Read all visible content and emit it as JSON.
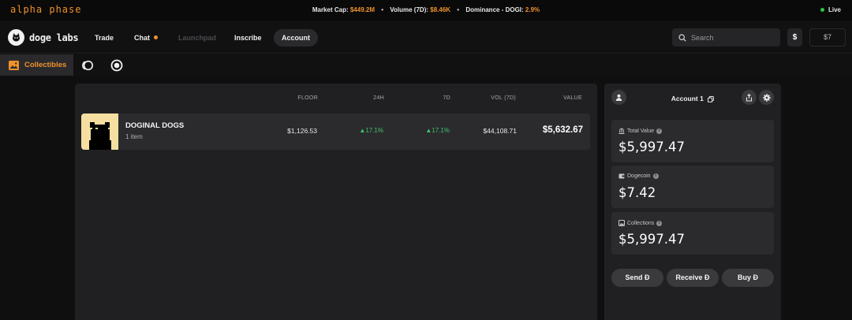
{
  "banner": {
    "brand": "alpha phase",
    "market_cap_label": "Market Cap:",
    "market_cap_value": "$449.2M",
    "volume_label": "Volume (7D):",
    "volume_value": "$8.46K",
    "dominance_label": "Dominance - DOGI:",
    "dominance_value": "2.9%",
    "live_label": "Live"
  },
  "nav": {
    "logo_text": "doge labs",
    "items": [
      {
        "label": "Trade"
      },
      {
        "label": "Chat"
      },
      {
        "label": "Launchpad"
      },
      {
        "label": "Inscribe"
      },
      {
        "label": "Account"
      }
    ],
    "search_placeholder": "Search",
    "currency_symbol": "$",
    "balance": "$7"
  },
  "subbar": {
    "collectibles_label": "Collectibles"
  },
  "table": {
    "headers": [
      "FLOOR",
      "24H",
      "7D",
      "VOL (7D)",
      "VALUE"
    ],
    "rows": [
      {
        "name": "DOGINAL DOGS",
        "count": "1 item",
        "floor": "$1,126.53",
        "change_24h": "17.1%",
        "change_7d": "17.1%",
        "vol_7d": "$44,108.71",
        "value": "$5,632.67"
      }
    ]
  },
  "account": {
    "title": "Account 1",
    "cards": [
      {
        "label": "Total Value",
        "value": "$5,997.47"
      },
      {
        "label": "Dogecoin",
        "value": "$7.42"
      },
      {
        "label": "Collections",
        "value": "$5,997.47"
      }
    ],
    "actions": [
      "Send Đ",
      "Receive Đ",
      "Buy Đ"
    ]
  },
  "colors": {
    "accent": "#f0922a",
    "positive": "#3fc56b",
    "live": "#27c93f",
    "panel": "#202022",
    "card": "#2b2b2e"
  }
}
